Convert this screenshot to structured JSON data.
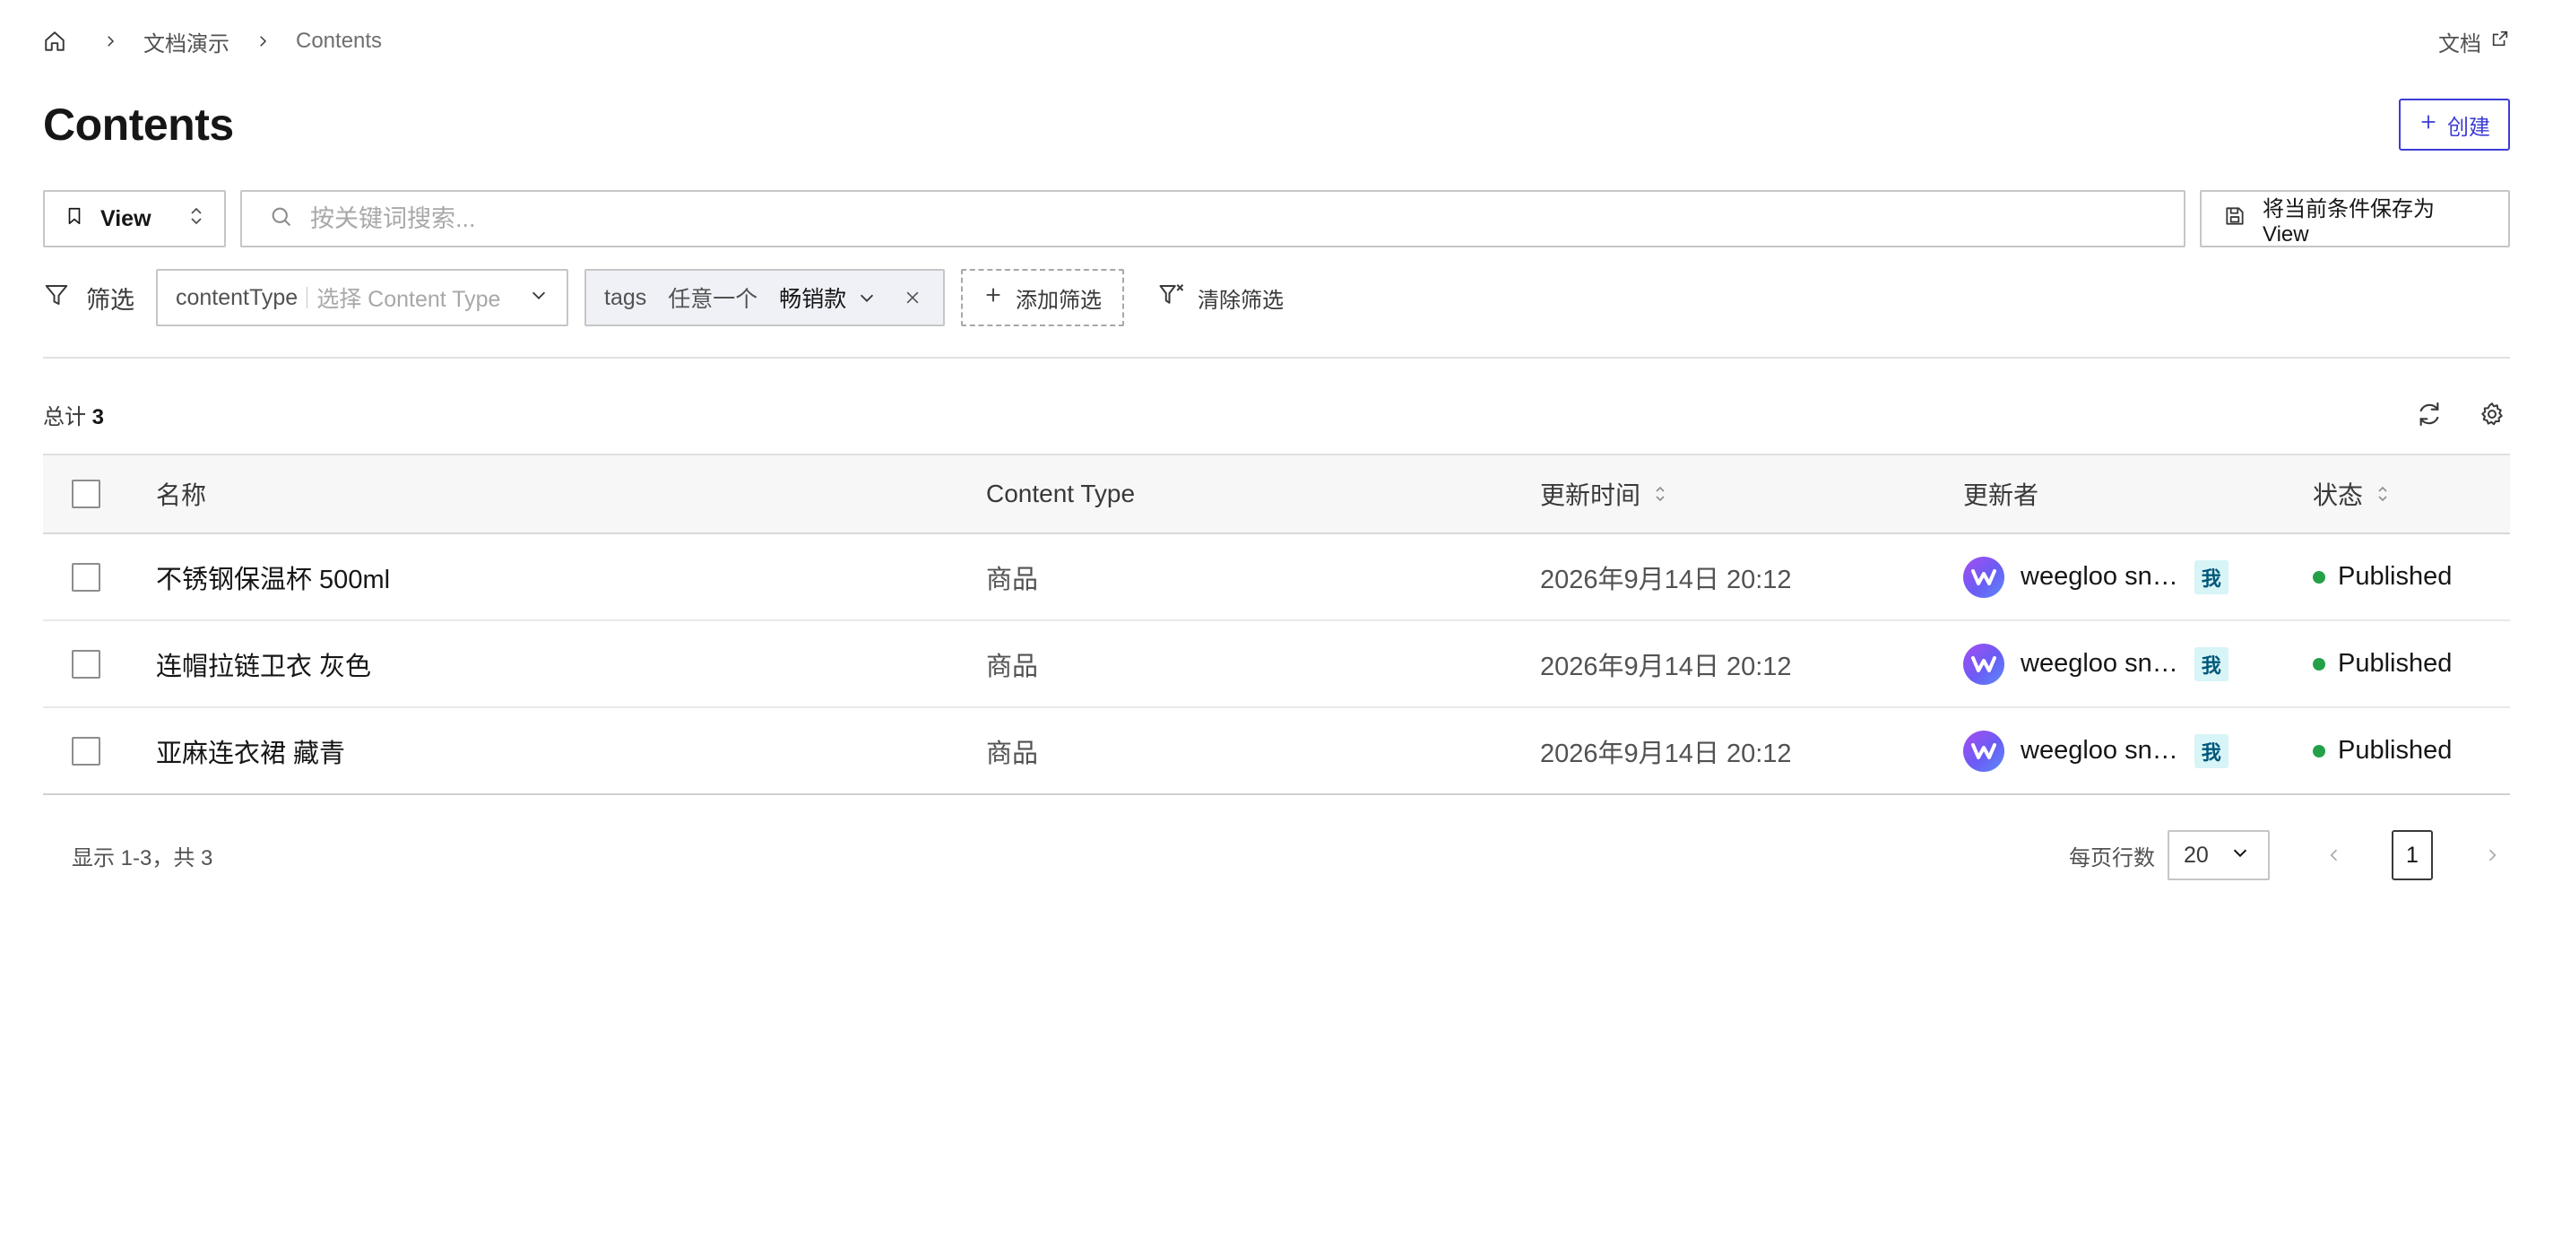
{
  "breadcrumb": {
    "home_icon": "home-icon",
    "items": [
      "文档演示",
      "Contents"
    ]
  },
  "docs_link": {
    "label": "文档",
    "icon": "external-link-icon"
  },
  "page_title": "Contents",
  "create_button": {
    "label": "创建",
    "icon": "plus-icon"
  },
  "view_button": {
    "label": "View",
    "icon": "bookmark-icon"
  },
  "search": {
    "placeholder": "按关键词搜索...",
    "value": ""
  },
  "save_view_button": {
    "label": "将当前条件保存为 View",
    "icon": "save-icon"
  },
  "filter": {
    "label": "筛选",
    "content_type": {
      "field": "contentType",
      "placeholder": "选择 Content Type"
    },
    "tags": {
      "field": "tags",
      "operator": "任意一个",
      "value": "畅销款"
    },
    "add_label": "添加筛选",
    "clear_label": "清除筛选"
  },
  "total": {
    "label": "总计",
    "count": "3"
  },
  "table": {
    "columns": {
      "name": "名称",
      "content_type": "Content Type",
      "updated_at": "更新时间",
      "updated_by": "更新者",
      "status": "状态"
    },
    "rows": [
      {
        "name": "不锈钢保温杯 500ml",
        "content_type": "商品",
        "updated_at": "2026年9月14日 20:12",
        "updated_by": "weegloo sn…",
        "me": "我",
        "status": "Published"
      },
      {
        "name": "连帽拉链卫衣 灰色",
        "content_type": "商品",
        "updated_at": "2026年9月14日 20:12",
        "updated_by": "weegloo sn…",
        "me": "我",
        "status": "Published"
      },
      {
        "name": "亚麻连衣裙 藏青",
        "content_type": "商品",
        "updated_at": "2026年9月14日 20:12",
        "updated_by": "weegloo sn…",
        "me": "我",
        "status": "Published"
      }
    ]
  },
  "pagination": {
    "range_text": "显示 1-3，共 3",
    "rows_per_page_label": "每页行数",
    "rows_per_page": "20",
    "current_page": "1"
  },
  "colors": {
    "accent": "#3d3dd6",
    "published": "#24a148",
    "me_badge_bg": "#d7f4f7"
  }
}
